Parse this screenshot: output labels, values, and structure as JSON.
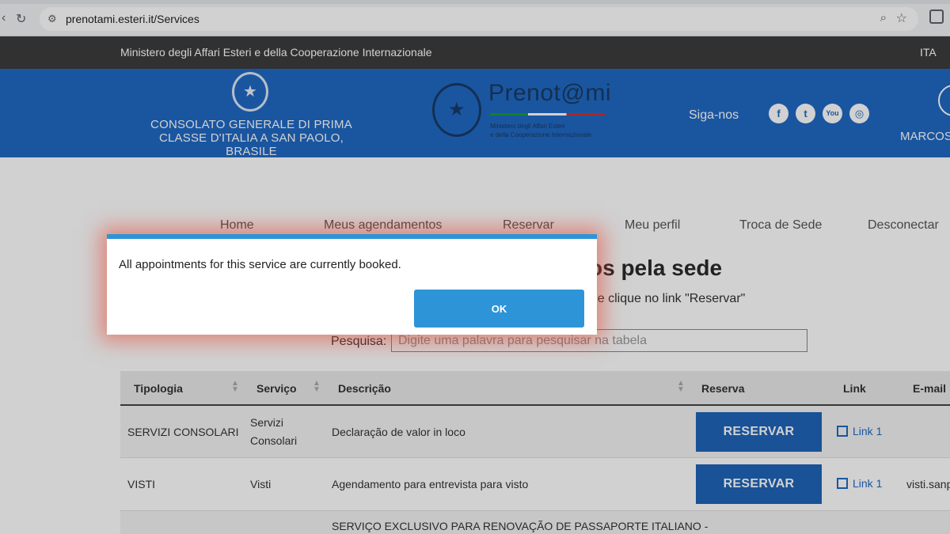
{
  "browser": {
    "url": "prenotami.esteri.it/Services",
    "nav_reload_icon": "reload-icon",
    "site_info_icon": "tune-icon"
  },
  "ministry_bar": {
    "text": "Ministero degli Affari Esteri e della Cooperazione Internazionale",
    "language": "ITA"
  },
  "header": {
    "consulate_name": "CONSOLATO GENERALE DI PRIMA CLASSE D'ITALIA A SAN PAOLO, BRASILE",
    "logo_text": "Prenot@mi",
    "logo_subtext_line1": "Ministero degli Affari Esteri",
    "logo_subtext_line2": "e della Cooperazione Internazionale",
    "follow_label": "Siga-nos",
    "social": [
      "f",
      "t",
      "You",
      "◎"
    ],
    "user_name": "MARCOS",
    "colors": {
      "blue": "#2069c4",
      "green": "#169b3c",
      "red": "#d0302b"
    }
  },
  "nav": {
    "items": [
      "Home",
      "Meus agendamentos",
      "Reservar",
      "Meu perfil",
      "Troca de Sede",
      "Desconectar"
    ]
  },
  "main": {
    "title_fragment": "os pela sede",
    "instructions_fragment": "r e clique no link \"Reservar\"",
    "search_label": "Pesquisa:",
    "search_placeholder": "Digite uma palavra para pesquisar na tabela"
  },
  "table": {
    "headers": [
      "Tipologia",
      "Serviço",
      "Descrição",
      "Reserva",
      "Link",
      "E-mail"
    ],
    "rows": [
      {
        "tipologia": "SERVIZI CONSOLARI",
        "servico_line1": "Servizi",
        "servico_line2": "Consolari",
        "descricao": "Declaração de valor in loco",
        "reserva": "RESERVAR",
        "link": "Link 1",
        "email": ""
      },
      {
        "tipologia": "VISTI",
        "servico_line1": "Visti",
        "servico_line2": "",
        "descricao": "Agendamento para entrevista para visto",
        "reserva": "RESERVAR",
        "link": "Link 1",
        "email": "visti.sanp"
      },
      {
        "tipologia": "",
        "servico_line1": "",
        "servico_line2": "",
        "descricao": "SERVIÇO EXCLUSIVO PARA RENOVAÇÃO DE PASSAPORTE ITALIANO -",
        "reserva": "",
        "link": "",
        "email": ""
      }
    ]
  },
  "modal": {
    "message": "All appointments for this service are currently booked.",
    "ok_label": "OK",
    "accent_color": "#2d94d8"
  }
}
